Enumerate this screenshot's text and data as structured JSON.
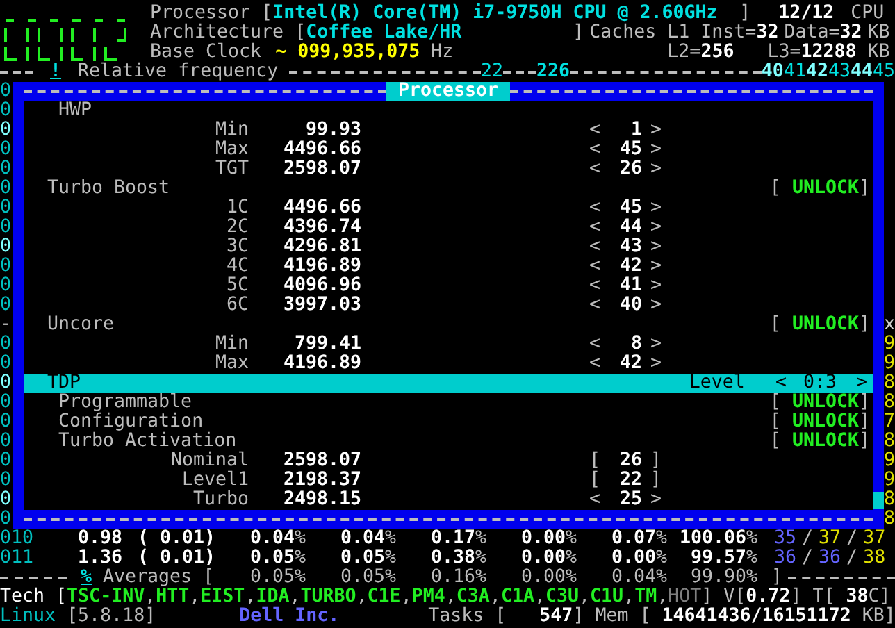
{
  "header": {
    "processor_label": "Processor [",
    "processor": "Intel(R) Core(TM) i7-9750H CPU @ 2.60GHz",
    "processor_close": "]",
    "cpu_count": "12/12",
    "cpu_label": "CPU",
    "architecture_label": "Architecture [",
    "architecture": "Coffee Lake/HR",
    "architecture_close": "]",
    "caches_label": "Caches L1 Inst=",
    "l1_inst": "32",
    "l1_data_label": "Data=",
    "l1_data": "32",
    "l1_unit": "KB",
    "base_clock_label": "Base Clock",
    "base_clock_tilde": "~",
    "base_clock": "099,935,075",
    "base_clock_unit": "Hz",
    "l2_label": "L2=",
    "l2": "256",
    "l3_label": "L3=",
    "l3": "12288",
    "l3_unit": "KB"
  },
  "ruler": {
    "marker": "!",
    "label": "Relative frequency",
    "mark_low": "22",
    "mark_high": "226",
    "scale": [
      "40",
      "41",
      "42",
      "43",
      "44",
      "45"
    ]
  },
  "dialog": {
    "title": "Processor",
    "left_edge": [
      {
        "text": "0",
        "color": "#00c0c0"
      },
      {
        "text": "0",
        "color": "#00c0c0"
      },
      {
        "text": "0",
        "color": "#80ffff"
      },
      {
        "text": "0",
        "color": "#00c0c0"
      },
      {
        "text": "0",
        "color": "#00c0c0"
      },
      {
        "text": "0",
        "color": "#00c0c0"
      },
      {
        "text": "0",
        "color": "#00c0c0"
      },
      {
        "text": "0",
        "color": "#00c0c0"
      },
      {
        "text": "0",
        "color": "#80ffff"
      },
      {
        "text": "0",
        "color": "#00c0c0"
      },
      {
        "text": "0",
        "color": "#00c0c0"
      },
      {
        "text": "0",
        "color": "#00c0c0"
      },
      {
        "text": "-",
        "color": "#d0d0d0"
      },
      {
        "text": "0",
        "color": "#00c0c0"
      },
      {
        "text": "0",
        "color": "#00c0c0"
      },
      {
        "text": "0",
        "color": "#80ffff"
      },
      {
        "text": "0",
        "color": "#00c0c0"
      },
      {
        "text": "0",
        "color": "#00c0c0"
      },
      {
        "text": "0",
        "color": "#00c0c0"
      },
      {
        "text": "0",
        "color": "#00c0c0"
      },
      {
        "text": "0",
        "color": "#00c0c0"
      },
      {
        "text": "0",
        "color": "#80ffff"
      },
      {
        "text": "0",
        "color": "#00c0c0"
      }
    ],
    "right_edge": [
      {
        "text": "x",
        "color": "#d0d0d0"
      },
      {
        "text": "9",
        "color": "#e0e000"
      },
      {
        "text": "9",
        "color": "#e0e000"
      },
      {
        "text": "8",
        "color": "#e0e000"
      },
      {
        "text": "8",
        "color": "#e0e000"
      },
      {
        "text": "7",
        "color": "#e0e000"
      },
      {
        "text": "8",
        "color": "#e0e000"
      },
      {
        "text": "9",
        "color": "#e0e000"
      },
      {
        "text": "9",
        "color": "#e0e000"
      },
      {
        "text": "8",
        "color": "#e0e000"
      },
      {
        "text": "8",
        "color": "#e0e000"
      }
    ],
    "rows": [
      {
        "kind": "group",
        "label": "HWP"
      },
      {
        "kind": "ratio",
        "label": "Min",
        "freq": "99.93",
        "open": "<",
        "ratio": "1",
        "close": ">"
      },
      {
        "kind": "ratio",
        "label": "Max",
        "freq": "4496.66",
        "open": "<",
        "ratio": "45",
        "close": ">"
      },
      {
        "kind": "ratio",
        "label": "TGT",
        "freq": "2598.07",
        "open": "<",
        "ratio": "26",
        "close": ">"
      },
      {
        "kind": "section",
        "label": "Turbo Boost",
        "status": {
          "open": "[",
          "text": "UNLOCK",
          "close": "]"
        }
      },
      {
        "kind": "ratio",
        "label": "1C",
        "freq": "4496.66",
        "open": "<",
        "ratio": "45",
        "close": ">"
      },
      {
        "kind": "ratio",
        "label": "2C",
        "freq": "4396.74",
        "open": "<",
        "ratio": "44",
        "close": ">"
      },
      {
        "kind": "ratio",
        "label": "3C",
        "freq": "4296.81",
        "open": "<",
        "ratio": "43",
        "close": ">"
      },
      {
        "kind": "ratio",
        "label": "4C",
        "freq": "4196.89",
        "open": "<",
        "ratio": "42",
        "close": ">"
      },
      {
        "kind": "ratio",
        "label": "5C",
        "freq": "4096.96",
        "open": "<",
        "ratio": "41",
        "close": ">"
      },
      {
        "kind": "ratio",
        "label": "6C",
        "freq": "3997.03",
        "open": "<",
        "ratio": "40",
        "close": ">"
      },
      {
        "kind": "section",
        "label": "Uncore",
        "status": {
          "open": "[",
          "text": "UNLOCK",
          "close": "]"
        }
      },
      {
        "kind": "ratio",
        "label": "Min",
        "freq": "799.41",
        "open": "<",
        "ratio": "8",
        "close": ">"
      },
      {
        "kind": "ratio",
        "label": "Max",
        "freq": "4196.89",
        "open": "<",
        "ratio": "42",
        "close": ">"
      },
      {
        "kind": "level",
        "label": "TDP",
        "selected": true,
        "level_label": "Level",
        "open": "<",
        "value": "0:3",
        "close": ">"
      },
      {
        "kind": "group",
        "label": "Programmable",
        "status": {
          "open": "[",
          "text": "UNLOCK",
          "close": "]"
        }
      },
      {
        "kind": "group",
        "label": "Configuration",
        "status": {
          "open": "[",
          "text": "UNLOCK",
          "close": "]"
        }
      },
      {
        "kind": "group",
        "label": "Turbo Activation",
        "status": {
          "open": "[",
          "text": "UNLOCK",
          "close": "]"
        }
      },
      {
        "kind": "ratio",
        "label": "Nominal",
        "freq": "2598.07",
        "open": "[",
        "ratio": "26",
        "close": "]"
      },
      {
        "kind": "ratio",
        "label": "Level1",
        "freq": "2198.37",
        "open": "[",
        "ratio": "22",
        "close": "]"
      },
      {
        "kind": "ratio",
        "label": "Turbo",
        "freq": "2498.15",
        "open": "<",
        "ratio": "25",
        "close": ">"
      }
    ]
  },
  "cores": [
    {
      "id": "010",
      "freq": "0.98",
      "ratio": "( 0.01)",
      "states": [
        {
          "value": "0.04",
          "unit": "%"
        },
        {
          "value": "0.04",
          "unit": "%"
        },
        {
          "value": "0.17",
          "unit": "%"
        },
        {
          "value": "0.00",
          "unit": "%"
        },
        {
          "value": "0.07",
          "unit": "%"
        },
        {
          "value": "100.06",
          "unit": "%"
        }
      ],
      "temps": [
        {
          "text": "35",
          "color": "#6464ff"
        },
        {
          "text": "/",
          "color": "#bcbcbc"
        },
        {
          "text": "37",
          "color": "#e0e000"
        },
        {
          "text": "/",
          "color": "#bcbcbc"
        },
        {
          "text": "37",
          "color": "#e0e000"
        }
      ]
    },
    {
      "id": "011",
      "freq": "1.36",
      "ratio": "( 0.01)",
      "states": [
        {
          "value": "0.05",
          "unit": "%"
        },
        {
          "value": "0.05",
          "unit": "%"
        },
        {
          "value": "0.38",
          "unit": "%"
        },
        {
          "value": "0.00",
          "unit": "%"
        },
        {
          "value": "0.00",
          "unit": "%"
        },
        {
          "value": "99.57",
          "unit": "%"
        }
      ],
      "temps": [
        {
          "text": "36",
          "color": "#6464ff"
        },
        {
          "text": "/",
          "color": "#bcbcbc"
        },
        {
          "text": "36",
          "color": "#6464ff"
        },
        {
          "text": "/",
          "color": "#bcbcbc"
        },
        {
          "text": "38",
          "color": "#e0e000"
        }
      ]
    }
  ],
  "averages": {
    "marker": "%",
    "label": "Averages [",
    "values": [
      "0.05%",
      "0.05%",
      "0.16%",
      "0.00%",
      "0.04%",
      "99.90%"
    ],
    "close": "]"
  },
  "tech": {
    "label": "Tech [",
    "items": [
      {
        "name": "TSC-INV",
        "enabled": true,
        "separator": ","
      },
      {
        "name": "HTT",
        "enabled": true,
        "separator": ","
      },
      {
        "name": "EIST",
        "enabled": true,
        "separator": ","
      },
      {
        "name": "IDA",
        "enabled": true,
        "separator": ","
      },
      {
        "name": "TURBO",
        "enabled": true,
        "separator": ","
      },
      {
        "name": "C1E",
        "enabled": true,
        "separator": ","
      },
      {
        "name": "PM4",
        "enabled": true,
        "separator": ","
      },
      {
        "name": "C3A",
        "enabled": true,
        "separator": ","
      },
      {
        "name": "C1A",
        "enabled": true,
        "separator": ","
      },
      {
        "name": "C3U",
        "enabled": true,
        "separator": ","
      },
      {
        "name": "C1U",
        "enabled": true,
        "separator": ","
      },
      {
        "name": "TM",
        "enabled": true,
        "separator": ","
      },
      {
        "name": "HOT",
        "enabled": false
      }
    ],
    "close": "]",
    "voltage_label": "V[",
    "voltage": "0.72",
    "voltage_close": "]",
    "temp_label": "T[",
    "temp": "38",
    "temp_close": "C]"
  },
  "footer": {
    "os": "Linux",
    "kernel": "[5.8.18]",
    "vendor": "Dell Inc.",
    "tasks_label": "Tasks [",
    "tasks": "547",
    "tasks_close": "]",
    "mem_label": "Mem [",
    "mem": "14641436/16151172",
    "mem_close": "KB]"
  }
}
